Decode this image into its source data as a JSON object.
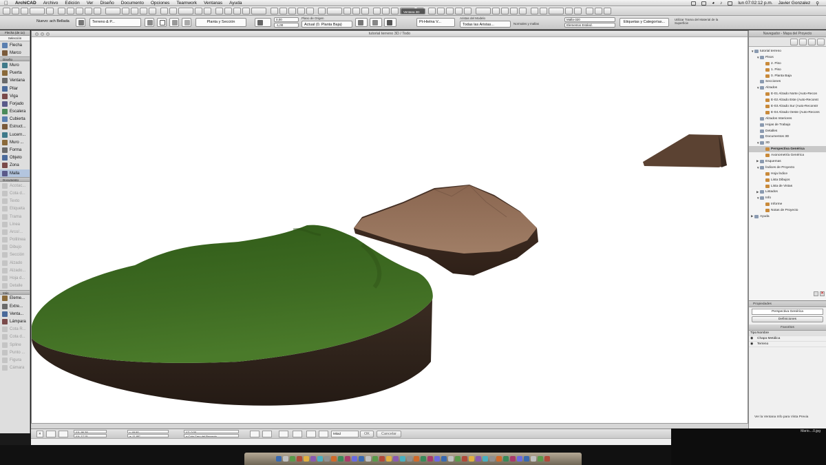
{
  "menubar": {
    "app_name": "ArchiCAD",
    "items": [
      "Archivo",
      "Edición",
      "Ver",
      "Diseño",
      "Documento",
      "Opciones",
      "Teamwork",
      "Ventanas",
      "Ayuda"
    ],
    "clock": "lun 07:02:12 p.m.",
    "user": "Javier Gonzalez"
  },
  "toolbar2": {
    "layer_label": "Nuevo: ach Bellada",
    "terrain_label": "Terreno & P...",
    "plan_section": "Planta y Sección",
    "elev1": "0,00",
    "elev2": "-1,00",
    "origin_label": "Plano de Origen",
    "origin_value": "Actual (0. Planta Baja)",
    "view_label": "Ventana 3D",
    "hatch_value": "Pt-Hielna V...",
    "edges_label": "Aristas del Modelo",
    "edges_value": "Todas las Aristas...",
    "normals_label": "Normales y mallas",
    "mesh_id": "Malla-320",
    "layer_field": "Elementos Estánd.",
    "tags_button": "Etiquetas y Categorías...",
    "material_label": "Utilizar Trama del Material de la Superficie"
  },
  "palette": {
    "header": "Flecha (de 1x)",
    "selection": "Selección",
    "top_tools": [
      "Flecha",
      "Marco"
    ],
    "section_design": "Diseño",
    "design_tools": [
      "Muro",
      "Puerta",
      "Ventana",
      "Pilar",
      "Viga",
      "Forjado",
      "Escalera",
      "Cubierta",
      "Estruct...",
      "Lucern...",
      "Muro ...",
      "Forma",
      "Objeto",
      "Zona",
      "Malla"
    ],
    "section_document": "Documento",
    "document_tools": [
      "Acotac...",
      "Cota d...",
      "Texto",
      "Etiqueta",
      "Trama",
      "Línea",
      "Arco/...",
      "Polilínea",
      "Dibujo",
      "Sección",
      "Alzado",
      "Alzado...",
      "Hoja d...",
      "Detalle"
    ],
    "section_more": "Más",
    "more_tools": [
      "Eleme...",
      "Extre...",
      "Venta...",
      "Lámpara",
      "Cota R...",
      "Cota d...",
      "Spline",
      "Punto ...",
      "Figura",
      "Cámara"
    ]
  },
  "viewport": {
    "title": "tutorial terreno 3D / Todo"
  },
  "infobar": {
    "dx": "ΔX: 96,38",
    "dy": "ΔY: 17,15",
    "r": "r: 49,90",
    "angle": "a: 11,80°",
    "dz": "ΔZ: 0,00",
    "zref": "a Cota Cero del Proyecto",
    "mode": "Mitad",
    "ok": "OK",
    "cancel": "Cancelar"
  },
  "navigator": {
    "title": "Navegador - Mapa del Proyecto",
    "tree": [
      {
        "label": "tutorial terreno",
        "level": 0,
        "expanded": true
      },
      {
        "label": "Pisos",
        "level": 1,
        "expanded": true
      },
      {
        "label": "2. Piso",
        "level": 2
      },
      {
        "label": "1. Piso",
        "level": 2
      },
      {
        "label": "0. Planta Baja",
        "level": 2
      },
      {
        "label": "Secciones",
        "level": 1
      },
      {
        "label": "Alzados",
        "level": 1,
        "expanded": true
      },
      {
        "label": "E-01 Alzado Norte (Auto-Recon",
        "level": 2
      },
      {
        "label": "E-02 Alzado Este (Auto-Reconst",
        "level": 2
      },
      {
        "label": "E-03 Alzado Sur (Auto-Reconstr",
        "level": 2
      },
      {
        "label": "E-04 Alzado Oeste (Auto-Recons",
        "level": 2
      },
      {
        "label": "Alzados Interiores",
        "level": 1
      },
      {
        "label": "Hojas de Trabajo",
        "level": 1
      },
      {
        "label": "Detalles",
        "level": 1
      },
      {
        "label": "Documentos 3D",
        "level": 1
      },
      {
        "label": "3D",
        "level": 1,
        "expanded": true
      },
      {
        "label": "Perspectiva Genérica",
        "level": 2,
        "selected": true
      },
      {
        "label": "Axonometría Genérica",
        "level": 2
      },
      {
        "label": "Esquemas",
        "level": 1,
        "collapsed": true
      },
      {
        "label": "Índices de Proyecto",
        "level": 1,
        "expanded": true
      },
      {
        "label": "Hoja Índice",
        "level": 2
      },
      {
        "label": "Lista Dibujos",
        "level": 2
      },
      {
        "label": "Lista de Vistas",
        "level": 2
      },
      {
        "label": "Listados",
        "level": 1,
        "collapsed": true
      },
      {
        "label": "Info",
        "level": 1,
        "expanded": true
      },
      {
        "label": "Informe",
        "level": 2
      },
      {
        "label": "Notas de Proyecto",
        "level": 2
      },
      {
        "label": "Ayuda",
        "level": 0,
        "collapsed": true
      }
    ]
  },
  "properties": {
    "title": "Propiedades",
    "view_name": "Perspectiva Genérica",
    "definitions_button": "Definiciones",
    "favorites_title": "Favoritos",
    "col_type": "Tipo",
    "col_name": "Nombre",
    "rows": [
      "Chapa Metálica",
      "Terreno"
    ],
    "note": "Ver la Ventana Info para Vista Previa"
  },
  "desktop": {
    "file_label": "Mario....0.jpg"
  }
}
